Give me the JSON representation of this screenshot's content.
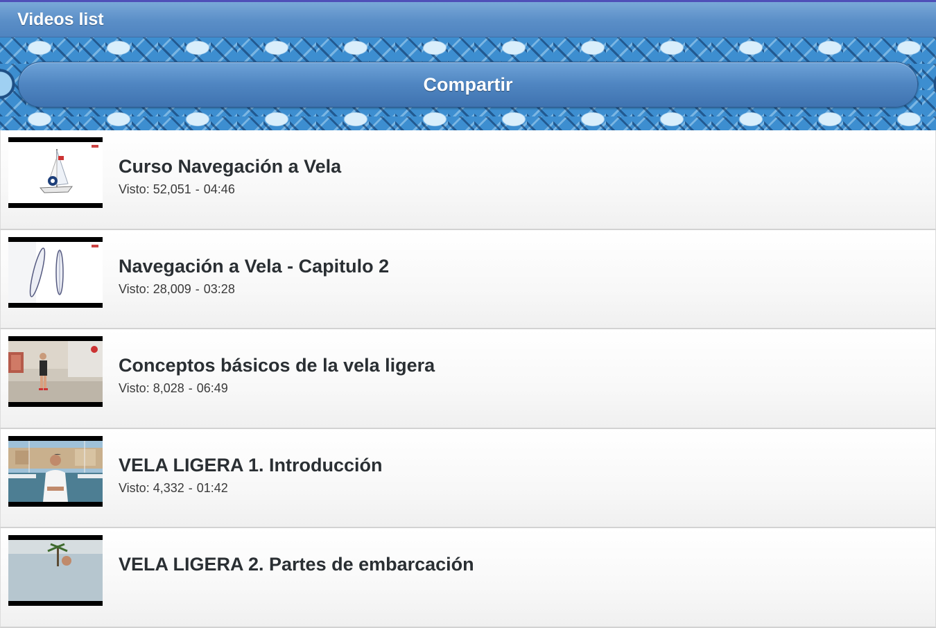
{
  "header": {
    "title": "Videos list"
  },
  "banner": {
    "share_label": "Compartir"
  },
  "videos": [
    {
      "title": "Curso Navegación a Vela",
      "views_label": "Visto:",
      "views": "52,051",
      "duration": "04:46",
      "thumbnail_icon": "sailboat-diagram-thumbnail"
    },
    {
      "title": "Navegación a Vela - Capitulo 2",
      "views_label": "Visto:",
      "views": "28,009",
      "duration": "03:28",
      "thumbnail_icon": "sail-shapes-thumbnail"
    },
    {
      "title": "Conceptos básicos de la vela ligera",
      "views_label": "Visto:",
      "views": "8,028",
      "duration": "06:49",
      "thumbnail_icon": "instructor-dock-thumbnail"
    },
    {
      "title": "VELA LIGERA 1. Introducción",
      "views_label": "Visto:",
      "views": "4,332",
      "duration": "01:42",
      "thumbnail_icon": "instructor-marina-thumbnail"
    },
    {
      "title": "VELA LIGERA 2. Partes de embarcación",
      "views_label": "",
      "views": "",
      "duration": "",
      "thumbnail_icon": "instructor-palms-thumbnail"
    }
  ],
  "colors": {
    "header": "#5a8ec7",
    "button": "#4f85c1",
    "banner": "#3d8ed0",
    "title_text": "#2a2f33"
  }
}
